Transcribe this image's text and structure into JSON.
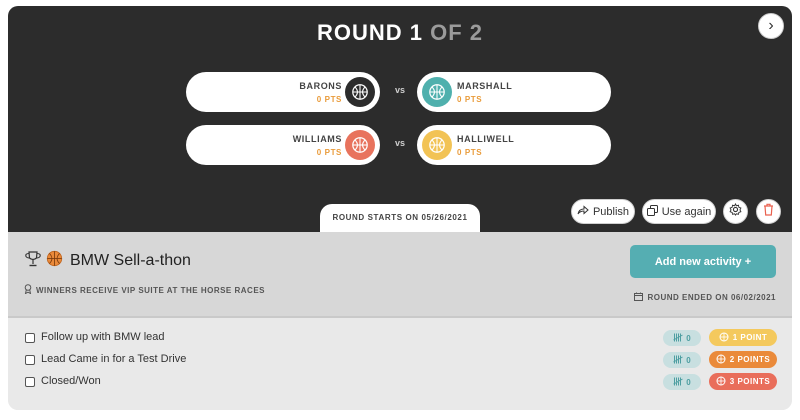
{
  "hero": {
    "round_label": "ROUND 1",
    "round_of": "OF 2",
    "matches": [
      {
        "left": {
          "name": "BARONS",
          "points": "0 PTS",
          "color": "#2c2c2c"
        },
        "vs": "vs",
        "right": {
          "name": "MARSHALL",
          "points": "0 PTS",
          "color": "#4fb0ad"
        }
      },
      {
        "left": {
          "name": "WILLIAMS",
          "points": "0 PTS",
          "color": "#e8735d"
        },
        "vs": "vs",
        "right": {
          "name": "HALLIWELL",
          "points": "0 PTS",
          "color": "#f2c355"
        }
      }
    ],
    "round_starts": "ROUND STARTS ON 05/26/2021",
    "actions": {
      "publish": "Publish",
      "use_again": "Use again"
    }
  },
  "contest": {
    "title": "BMW Sell-a-thon",
    "prize": "WINNERS RECEIVE VIP SUITE AT THE HORSE RACES",
    "add_activity": "Add new activity +",
    "round_ended": "ROUND ENDED ON 06/02/2021"
  },
  "activities": [
    {
      "label": "Follow up with BMW lead",
      "count": "0",
      "points": "1 POINT",
      "color": "#f4c95d"
    },
    {
      "label": "Lead Came in for a Test Drive",
      "count": "0",
      "points": "2 POINTS",
      "color": "#ea8a3a"
    },
    {
      "label": "Closed/Won",
      "count": "0",
      "points": "3 POINTS",
      "color": "#e96e5b"
    }
  ],
  "colors": {
    "accent": "#55aeb2",
    "dark": "#2c2c2c",
    "points_text": "#e99b3a"
  }
}
